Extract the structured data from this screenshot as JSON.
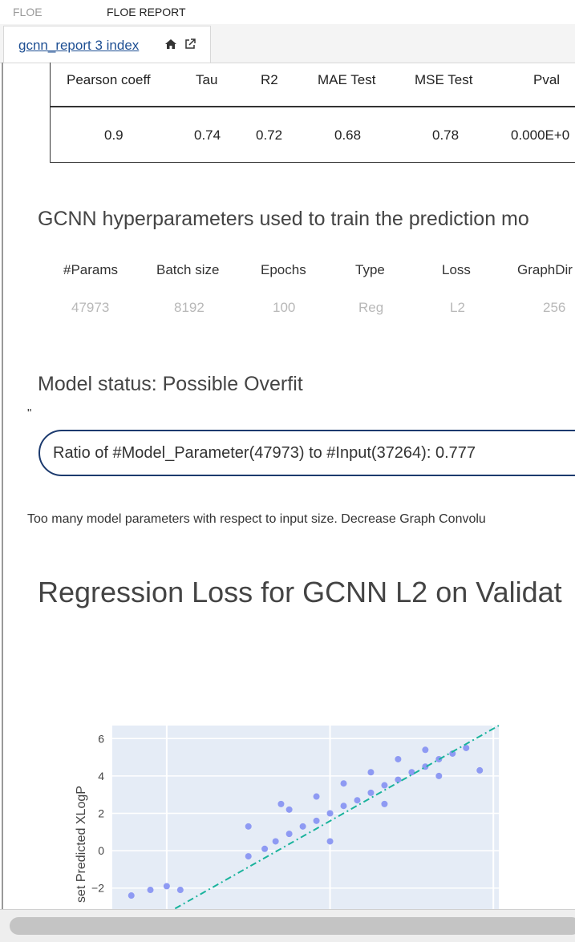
{
  "header": {
    "brand": "FLOE",
    "report_title": "FLOE REPORT"
  },
  "tab": {
    "label": "gcnn_report 3 index",
    "home_icon": "home-icon",
    "external_icon": "external-link-icon"
  },
  "metrics": {
    "headers": [
      "Pearson coeff",
      "Tau",
      "R2",
      "MAE Test",
      "MSE Test",
      "Pval"
    ],
    "values": [
      "0.9",
      "0.74",
      "0.72",
      "0.68",
      "0.78",
      "0.000E+0"
    ]
  },
  "hyper": {
    "title": "GCNN hyperparameters used to train the prediction mo",
    "headers": [
      "#Params",
      "Batch size",
      "Epochs",
      "Type",
      "Loss",
      "GraphDir"
    ],
    "values": [
      "47973",
      "8192",
      "100",
      "Reg",
      "L2",
      "256"
    ]
  },
  "status": {
    "title": "Model status: Possible Overfit",
    "quote": "\"",
    "ratio": "Ratio of #Model_Parameter(47973) to #Input(37264): 0.777",
    "warning": "Too many model parameters with respect to input size. Decrease Graph Convolu"
  },
  "loss": {
    "title": "Regression Loss for GCNN L2 on Validat"
  },
  "chart_data": {
    "type": "scatter",
    "ylabel": "set Predicted XLogP",
    "xlabel": "",
    "yticks": [
      "6",
      "4",
      "2",
      "0",
      "−2"
    ],
    "ylim": [
      -3.3,
      6.7
    ],
    "xlim": [
      -5,
      9.2
    ],
    "x_gridlines": [
      -3,
      3,
      9
    ],
    "marker_color": "#8e9af3",
    "line_color": "#1ab39c",
    "plot_bg": "#e5ecf6",
    "identity_line": {
      "from": [
        -5,
        -5
      ],
      "to": [
        9.2,
        6.7
      ]
    },
    "series": [
      {
        "x": [
          0.0,
          0.6,
          1.0,
          1.5,
          2.0,
          2.5,
          3.0,
          3.5,
          4.0,
          4.5,
          5.0,
          5.5,
          6.0,
          6.5,
          7.0,
          7.5,
          8.0,
          1.5,
          2.5,
          3.5,
          4.5,
          5.5,
          6.5,
          -2.5,
          -3.0,
          -3.6,
          -4.3,
          0.0,
          1.2,
          3.0,
          5.0,
          7.0,
          8.5
        ],
        "y": [
          -0.3,
          0.1,
          0.5,
          0.9,
          1.3,
          1.6,
          2.0,
          2.4,
          2.7,
          3.1,
          3.5,
          3.8,
          4.2,
          4.5,
          4.9,
          5.2,
          5.5,
          2.2,
          2.9,
          3.6,
          4.2,
          4.9,
          5.4,
          -2.1,
          -1.9,
          -2.1,
          -2.4,
          1.3,
          2.5,
          0.5,
          2.5,
          4.0,
          4.3
        ]
      }
    ]
  }
}
